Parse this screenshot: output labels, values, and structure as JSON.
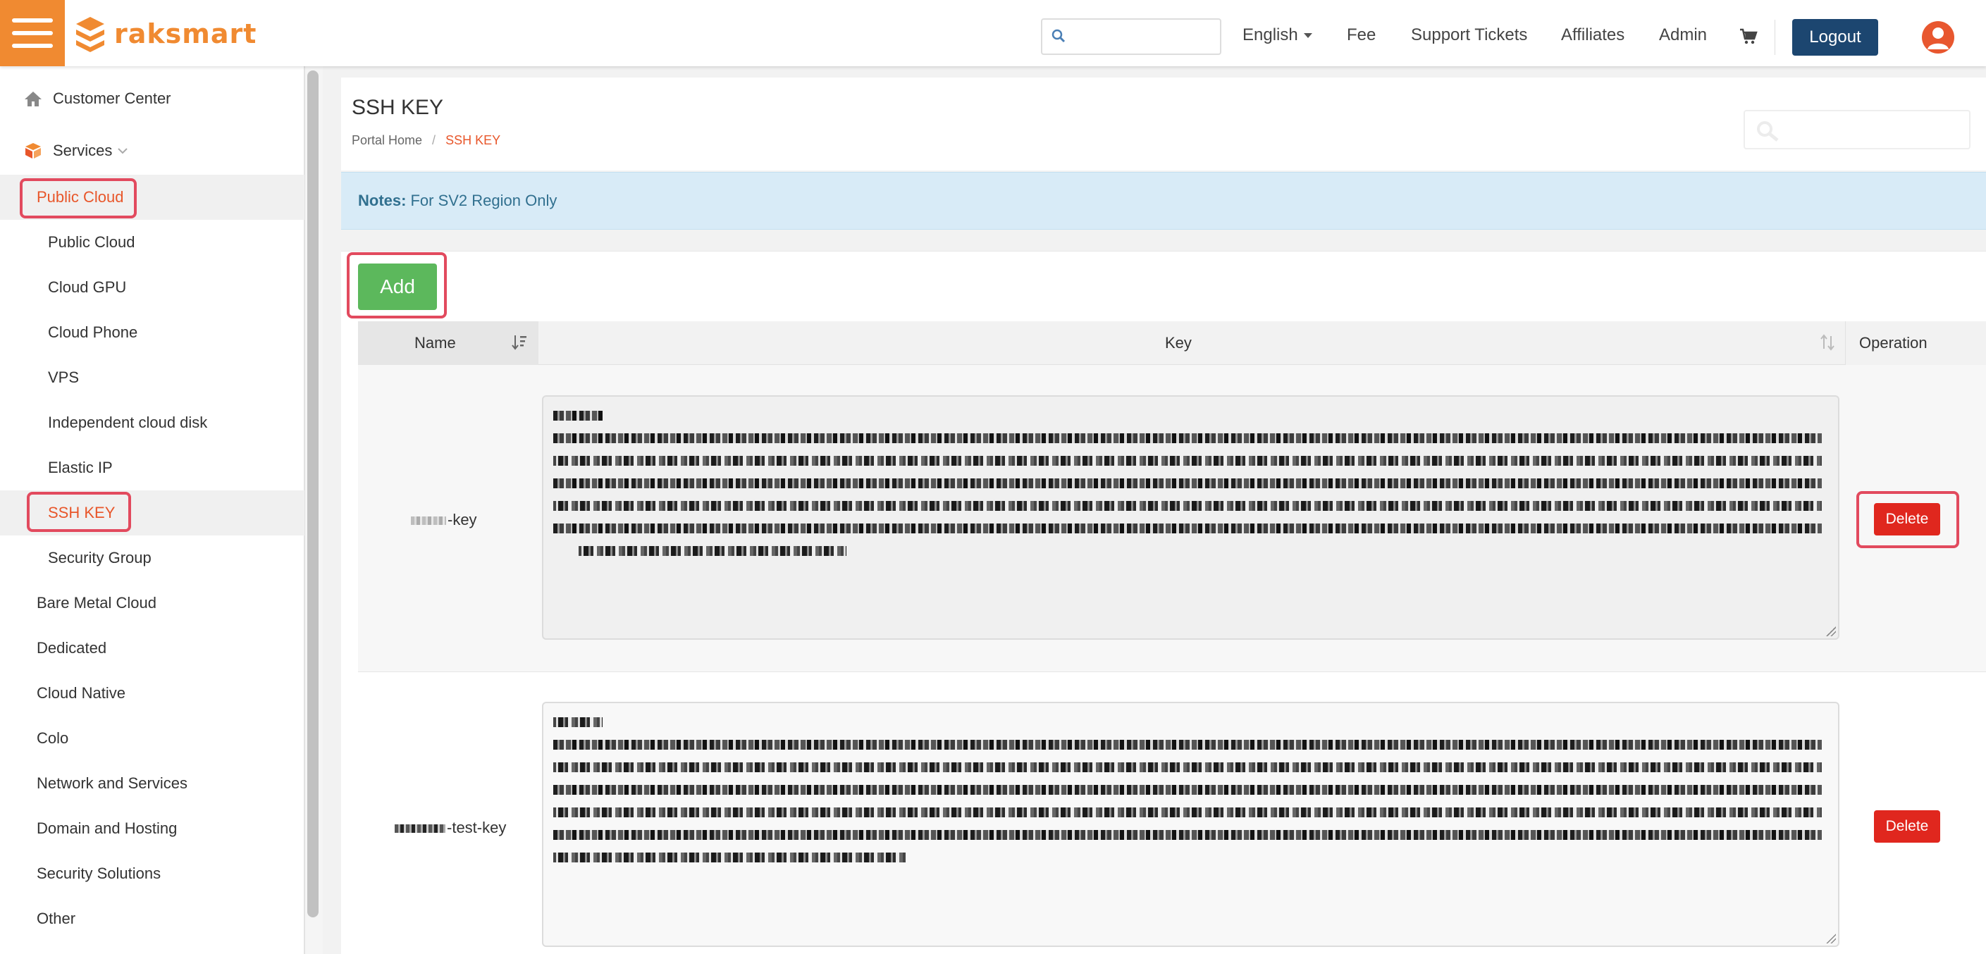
{
  "header": {
    "brand": "raksmart",
    "search": {
      "value": "",
      "placeholder": ""
    },
    "nav": {
      "language": "English",
      "fee": "Fee",
      "support_tickets": "Support Tickets",
      "affiliates": "Affiliates",
      "admin": "Admin",
      "logout": "Logout"
    },
    "brand_color": "#f08a31",
    "logout_color": "#1c4670"
  },
  "sidebar": {
    "customer_center": "Customer Center",
    "services": "Services",
    "public_cloud_group": "Public Cloud",
    "public_cloud_items": [
      "Public Cloud",
      "Cloud GPU",
      "Cloud Phone",
      "VPS",
      "Independent cloud disk",
      "Elastic IP",
      "SSH KEY",
      "Security Group"
    ],
    "other_items": [
      "Bare Metal Cloud",
      "Dedicated",
      "Cloud Native",
      "Colo",
      "Network and Services",
      "Domain and Hosting",
      "Security Solutions",
      "Other"
    ],
    "active_color": "#e8562a"
  },
  "page": {
    "title": "SSH KEY",
    "breadcrumb": {
      "home": "Portal Home",
      "separator": "/",
      "current": "SSH KEY"
    },
    "notes_label": "Notes:",
    "notes_text": "For SV2 Region Only",
    "add_label": "Add"
  },
  "table": {
    "columns": {
      "name": "Name",
      "key": "Key",
      "operation": "Operation"
    },
    "rows": [
      {
        "name_suffix": "-key",
        "delete_label": "Delete"
      },
      {
        "name_suffix": "-test-key",
        "delete_label": "Delete"
      }
    ],
    "add_color": "#5cb85c",
    "delete_color": "#e0271e"
  }
}
